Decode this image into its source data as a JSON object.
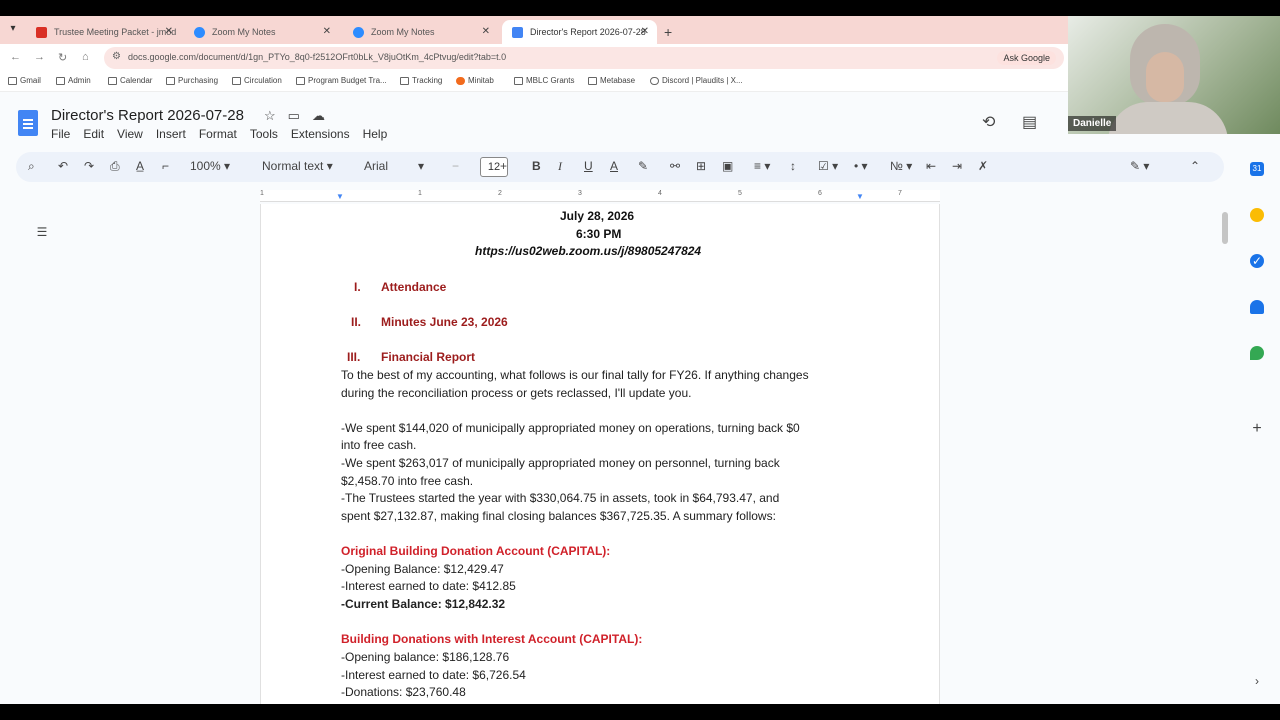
{
  "browser": {
    "tabs": [
      {
        "label": "Trustee Meeting Packet - jmod",
        "favicon_color": "#d93025"
      },
      {
        "label": "Zoom My Notes",
        "favicon_color": "#2d8cff"
      },
      {
        "label": "Zoom My Notes",
        "favicon_color": "#2d8cff"
      },
      {
        "label": "Director's Report 2026-07-28",
        "favicon_color": "#4285f4"
      }
    ],
    "new_tab": "+",
    "url": "docs.google.com/document/d/1gn_PTYo_8q0-f2512OFrt0bLk_V8juOtKm_4cPtvug/edit?tab=t.0",
    "ask_google": "Ask Google",
    "bookmarks": [
      "Gmail",
      "Admin",
      "Calendar",
      "Purchasing",
      "Circulation",
      "Program Budget Tra...",
      "Tracking",
      "Minitab",
      "MBLC Grants",
      "Metabase",
      "Discord | Plaudits | X..."
    ]
  },
  "docs": {
    "title": "Director's Report 2026-07-28",
    "menu": [
      "File",
      "Edit",
      "View",
      "Insert",
      "Format",
      "Tools",
      "Extensions",
      "Help"
    ],
    "toolbar": {
      "zoom": "100%",
      "style": "Normal text",
      "font": "Arial",
      "font_size": "12",
      "minus": "−",
      "plus": "+"
    },
    "ruler_numbers": [
      "1",
      "1",
      "2",
      "3",
      "4",
      "5",
      "6",
      "7"
    ]
  },
  "document": {
    "date": "July 28, 2026",
    "time": "6:30 PM",
    "link": "https://us02web.zoom.us/j/89805247824",
    "sections": [
      {
        "num": "I.",
        "title": "Attendance"
      },
      {
        "num": "II.",
        "title": "Minutes June 23, 2026"
      },
      {
        "num": "III.",
        "title": "Financial Report"
      }
    ],
    "para1_line1": "To the best of my accounting, what follows is our final tally for FY26. If anything changes",
    "para1_line2": "during the reconciliation process or gets reclassed, I'll update you.",
    "b1_l1": "-We spent $144,020 of municipally appropriated money on operations, turning back $0",
    "b1_l2": "into free cash.",
    "b2_l1": "-We spent $263,017 of municipally appropriated money on personnel, turning back",
    "b2_l2": "$2,458.70 into free cash.",
    "b3_l1": "-The Trustees started the year with $330,064.75 in assets, took in $64,793.47, and",
    "b3_l2": "spent $27,132.87, making final closing balances $367,725.35. A summary follows:",
    "acct1_title": "Original Building Donation Account (CAPITAL):",
    "acct1_open": "-Opening Balance: $12,429.47",
    "acct1_interest": "-Interest earned to date: $412.85",
    "acct1_current": "-Current Balance: $12,842.32",
    "acct2_title": "Building Donations with Interest Account (CAPITAL):",
    "acct2_open": "-Opening balance: $186,128.76",
    "acct2_interest": "-Interest earned to date: $6,726.54",
    "acct2_donations": "-Donations: $23,760.48"
  },
  "video": {
    "participant_name": "Danielle"
  }
}
